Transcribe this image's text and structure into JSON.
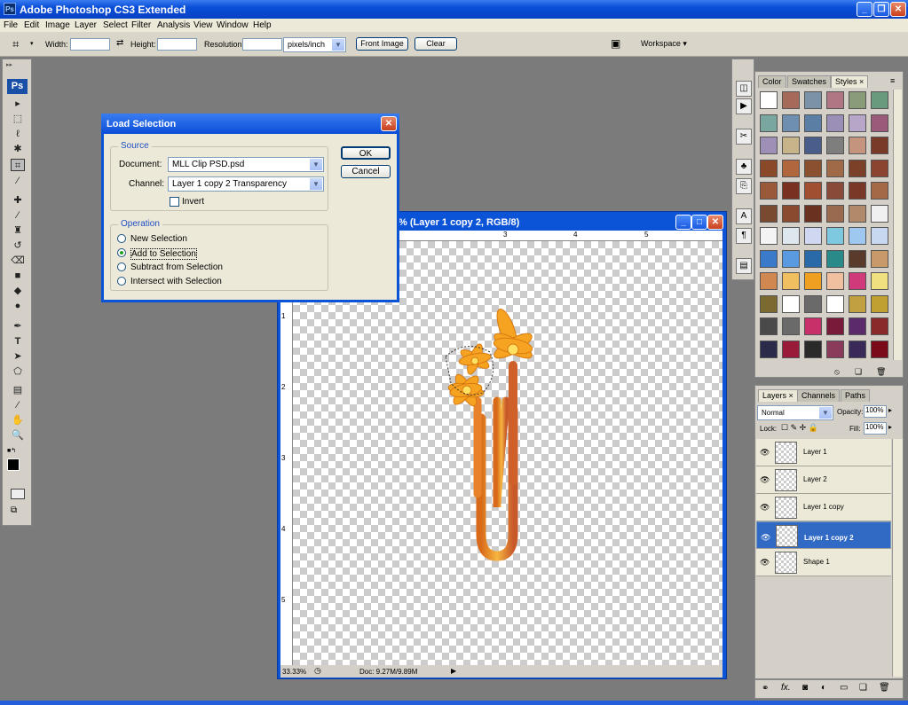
{
  "app": {
    "title": "Adobe Photoshop CS3 Extended",
    "icon_label": "Ps"
  },
  "menu": [
    "File",
    "Edit",
    "Image",
    "Layer",
    "Select",
    "Filter",
    "Analysis",
    "View",
    "Window",
    "Help"
  ],
  "options": {
    "width_label": "Width:",
    "height_label": "Height:",
    "resolution_label": "Resolution:",
    "units": "pixels/inch",
    "front_image": "Front Image",
    "clear": "Clear",
    "workspace": "Workspace ▾"
  },
  "toolbox": {
    "logo": "Ps",
    "tools": [
      "move-tool",
      "marquee-tool",
      "lasso-tool",
      "magic-wand-tool",
      "crop-tool",
      "slice-tool",
      "healing-brush-tool",
      "brush-tool",
      "clone-stamp-tool",
      "history-brush-tool",
      "eraser-tool",
      "gradient-tool",
      "blur-tool",
      "dodge-tool",
      "pen-tool",
      "type-tool",
      "path-selection-tool",
      "shape-tool",
      "notes-tool",
      "eyedropper-tool",
      "hand-tool",
      "zoom-tool"
    ]
  },
  "dialog": {
    "title": "Load Selection",
    "source_label": "Source",
    "document_label": "Document:",
    "document_value": "MLL Clip PSD.psd",
    "channel_label": "Channel:",
    "channel_value": "Layer 1 copy 2 Transparency",
    "invert_label": "Invert",
    "operation_label": "Operation",
    "ops": [
      "New Selection",
      "Add to Selection",
      "Subtract from Selection",
      "Intersect with Selection"
    ],
    "selected_op": 1,
    "ok": "OK",
    "cancel": "Cancel"
  },
  "document": {
    "title": "% (Layer 1 copy 2, RGB/8)",
    "zoom": "33.33%",
    "doc_size": "Doc: 9.27M/9.89M",
    "ruler_top": [
      "3",
      "4",
      "5"
    ],
    "ruler_left": [
      "1",
      "2",
      "3",
      "4",
      "5"
    ]
  },
  "styles_panel": {
    "tabs": [
      "Color",
      "Swatches",
      "Styles"
    ],
    "active_tab": "Styles",
    "swatch_colors": [
      "#ffffff",
      "#a56a5a",
      "#7b93a6",
      "#b07684",
      "#8a9b7a",
      "#6a9a7e",
      "#7aa6a0",
      "#6f8fb0",
      "#5b7ea5",
      "#9b8fb8",
      "#b8a6c8",
      "#9c5a7a",
      "#9e8fb7",
      "#c8b48a",
      "#4b5d8a",
      "#7e7e7e",
      "#c4947e",
      "#7a3a2a",
      "#8a4a2a",
      "#b0673e",
      "#8a5030",
      "#a06a48",
      "#7a4028",
      "#8a4430",
      "#9a5a3a",
      "#7a3020",
      "#a05030",
      "#8a4a3a",
      "#7a3828",
      "#a46a48",
      "#7a4a30",
      "#8a4a30",
      "#6a3020",
      "#9a6a50",
      "#b08a6a",
      "#f0f0f0",
      "#f4f4f4",
      "#dfe7ee",
      "#cfd8f0",
      "#7ec8e0",
      "#9ec8f0",
      "#c8d8f0",
      "#3a7ac8",
      "#5a9ae0",
      "#2a6aa8",
      "#2a8a8a",
      "#5a3a2a",
      "#c89a6a",
      "#d08850",
      "#f0c060",
      "#f0a020",
      "#f0c0a0",
      "#d03a7a",
      "#f0e080",
      "#7a6a30",
      "#ffffff",
      "#6a6a6a",
      "#ffffff",
      "#c0a040",
      "#c0a030",
      "#4a4a4a",
      "#6a6a6a",
      "#c8306a",
      "#7a1a3a",
      "#5a2a6a",
      "#8a2a2a",
      "#2a2a4a",
      "#9a1a3a",
      "#2a2a2a",
      "#8a3a5a",
      "#3a2a5a",
      "#7a0a1a"
    ]
  },
  "layers_panel": {
    "tabs": [
      "Layers",
      "Channels",
      "Paths"
    ],
    "blend_mode": "Normal",
    "opacity_label": "Opacity:",
    "opacity_value": "100%",
    "lock_label": "Lock:",
    "fill_label": "Fill:",
    "fill_value": "100%",
    "layers": [
      {
        "name": "Layer 1",
        "selected": false
      },
      {
        "name": "Layer 2",
        "selected": false
      },
      {
        "name": "Layer 1 copy",
        "selected": false
      },
      {
        "name": "Layer 1 copy 2",
        "selected": true
      },
      {
        "name": "Shape 1",
        "selected": false
      }
    ]
  }
}
